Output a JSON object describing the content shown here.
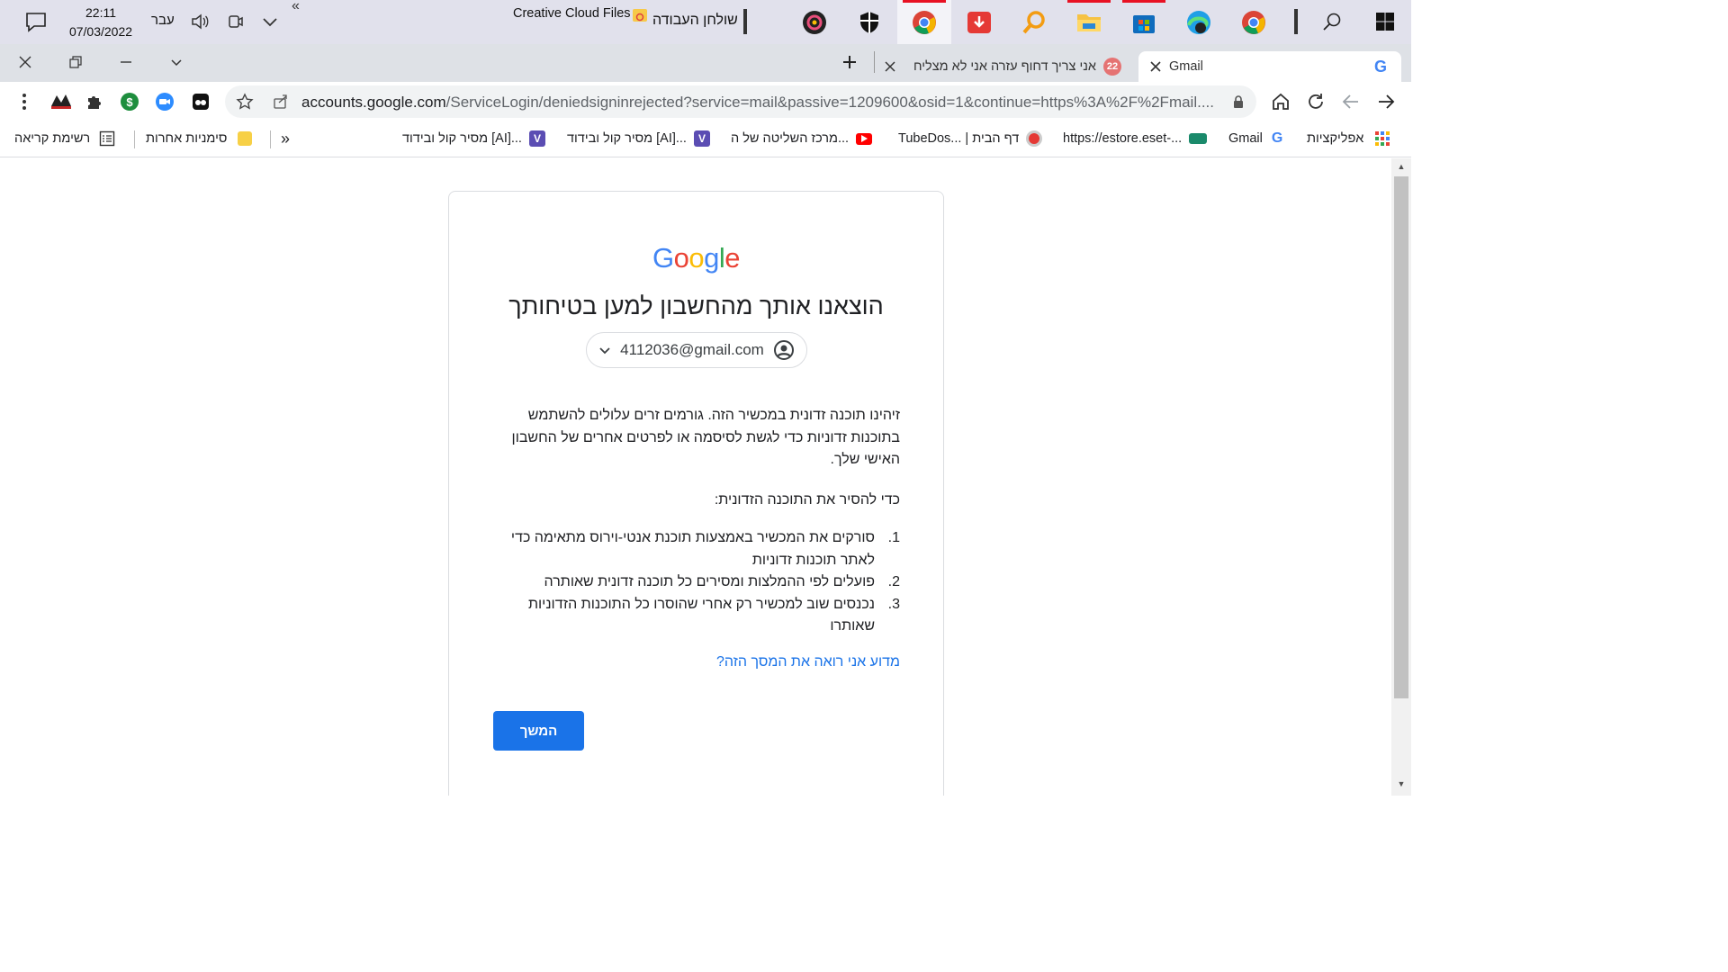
{
  "taskbar": {
    "time": "22:11",
    "date": "07/03/2022",
    "language": "עבר",
    "chevron": "«",
    "creative_cloud": "Creative Cloud Files",
    "desktop": "שולחן העבודה"
  },
  "tabs": {
    "inactive_title": "אני צריך דחוף עזרה אני לא מצליח",
    "active_title": "Gmail",
    "inactive_badge": "22"
  },
  "toolbar": {
    "url_host": "accounts.google.com",
    "url_path": "/ServiceLogin/deniedsigninrejected?service=mail&passive=1209600&osid=1&continue=https%3A%2F%2Fmail...."
  },
  "bookmarks": {
    "reading_list": "רשימת קריאה",
    "other_bookmarks": "סימניות אחרות",
    "overflow": "»",
    "items": [
      "מסיר קול ובידוד [AI]...",
      "מסיר קול ובידוד [AI]...",
      "מרכז השליטה של ה...",
      "TubeDos... | דף הבית",
      "https://estore.eset-...",
      "Gmail",
      "אפליקציות"
    ]
  },
  "page": {
    "logo": [
      "G",
      "o",
      "o",
      "g",
      "l",
      "e"
    ],
    "logo_colors": [
      "#4285f4",
      "#ea4335",
      "#fbbc05",
      "#4285f4",
      "#34a853",
      "#ea4335"
    ],
    "heading": "הוצאנו אותך מהחשבון למען בטיחותך",
    "account_email": "4112036@gmail.com",
    "paragraph": "זיהינו תוכנה זדונית במכשיר הזה. גורמים זרים עלולים להשתמש בתוכנות זדוניות כדי לגשת לסיסמה או לפרטים אחרים של החשבון האישי שלך.",
    "remove_intro": "כדי להסיר את התוכנה הזדונית:",
    "steps": [
      {
        "num": "1.",
        "text": "סורקים את המכשיר באמצעות תוכנת אנטי-וירוס מתאימה כדי לאתר תוכנות זדוניות"
      },
      {
        "num": "2.",
        "text": "פועלים לפי ההמלצות ומסירים כל תוכנה זדונית שאותרה"
      },
      {
        "num": "3.",
        "text": "נכנסים שוב למכשיר רק אחרי שהוסרו כל התוכנות הזדוניות שאותרו"
      }
    ],
    "help_link": "מדוע אני רואה את המסך הזה?",
    "continue_button": "המשך"
  },
  "colors": {
    "accent": "#1a73e8",
    "taskbar_bg": "#e1e1ec",
    "tabstrip_bg": "#dee1e6"
  }
}
